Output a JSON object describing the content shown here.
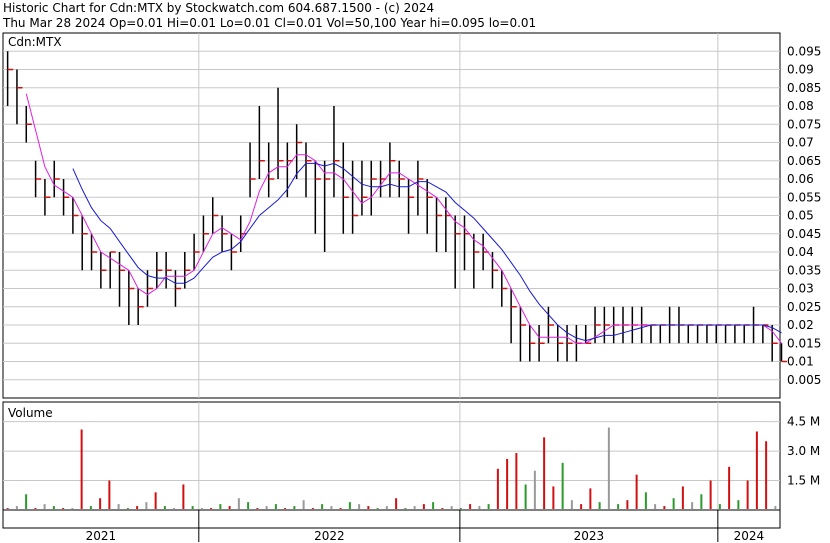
{
  "header": {
    "line1": "Historic Chart for Cdn:MTX by Stockwatch.com 604.687.1500 - (c) 2024",
    "line2": "Thu Mar 28 2024  Op=0.01  Hi=0.01  Lo=0.01  Cl=0.01  Vol=50,100  Year hi=0.095  lo=0.01"
  },
  "chart_data": [
    {
      "type": "line",
      "title": "Cdn:MTX",
      "y_ticks": [
        "0.095",
        "0.09",
        "0.085",
        "0.08",
        "0.075",
        "0.07",
        "0.065",
        "0.06",
        "0.055",
        "0.05",
        "0.045",
        "0.04",
        "0.035",
        "0.03",
        "0.025",
        "0.02",
        "0.015",
        "0.01",
        "0.005"
      ],
      "ylim": [
        0,
        0.1
      ],
      "x_labels": [
        "2021",
        "2022",
        "2023",
        "2024"
      ],
      "grid": true,
      "series": [],
      "moving_average_colors": {
        "short": "#e020e0",
        "long": "#1a1ad0"
      },
      "price": {
        "x": [
          0.0,
          0.012,
          0.024,
          0.036,
          0.048,
          0.06,
          0.072,
          0.084,
          0.096,
          0.108,
          0.12,
          0.132,
          0.144,
          0.156,
          0.168,
          0.18,
          0.192,
          0.204,
          0.216,
          0.228,
          0.24,
          0.252,
          0.264,
          0.276,
          0.288,
          0.3,
          0.312,
          0.324,
          0.336,
          0.348,
          0.36,
          0.372,
          0.384,
          0.396,
          0.408,
          0.42,
          0.432,
          0.444,
          0.456,
          0.468,
          0.48,
          0.492,
          0.504,
          0.516,
          0.528,
          0.54,
          0.552,
          0.564,
          0.576,
          0.588,
          0.6,
          0.612,
          0.624,
          0.636,
          0.648,
          0.66,
          0.672,
          0.684,
          0.696,
          0.708,
          0.72,
          0.732,
          0.744,
          0.756,
          0.768,
          0.78,
          0.792,
          0.804,
          0.816,
          0.828,
          0.84,
          0.852,
          0.864,
          0.876,
          0.888,
          0.9,
          0.912,
          0.924,
          0.936,
          0.948,
          0.96,
          0.972,
          0.984,
          0.996
        ],
        "close": [
          0.09,
          0.085,
          0.075,
          0.06,
          0.055,
          0.06,
          0.055,
          0.05,
          0.045,
          0.04,
          0.035,
          0.04,
          0.035,
          0.03,
          0.025,
          0.03,
          0.035,
          0.035,
          0.03,
          0.035,
          0.04,
          0.045,
          0.05,
          0.045,
          0.04,
          0.045,
          0.06,
          0.065,
          0.06,
          0.065,
          0.065,
          0.07,
          0.065,
          0.06,
          0.06,
          0.065,
          0.055,
          0.05,
          0.055,
          0.06,
          0.06,
          0.065,
          0.06,
          0.055,
          0.06,
          0.055,
          0.05,
          0.05,
          0.045,
          0.045,
          0.04,
          0.04,
          0.035,
          0.03,
          0.025,
          0.02,
          0.015,
          0.015,
          0.02,
          0.015,
          0.015,
          0.015,
          0.015,
          0.02,
          0.02,
          0.02,
          0.02,
          0.02,
          0.02,
          0.02,
          0.02,
          0.02,
          0.02,
          0.02,
          0.02,
          0.02,
          0.02,
          0.02,
          0.02,
          0.02,
          0.02,
          0.02,
          0.015,
          0.01
        ],
        "high": [
          0.095,
          0.09,
          0.08,
          0.065,
          0.06,
          0.065,
          0.06,
          0.055,
          0.05,
          0.045,
          0.04,
          0.04,
          0.04,
          0.035,
          0.03,
          0.035,
          0.04,
          0.04,
          0.035,
          0.04,
          0.045,
          0.05,
          0.055,
          0.05,
          0.045,
          0.05,
          0.07,
          0.08,
          0.07,
          0.085,
          0.07,
          0.075,
          0.07,
          0.065,
          0.065,
          0.08,
          0.07,
          0.065,
          0.065,
          0.065,
          0.065,
          0.07,
          0.065,
          0.06,
          0.065,
          0.06,
          0.055,
          0.055,
          0.05,
          0.05,
          0.045,
          0.045,
          0.04,
          0.035,
          0.03,
          0.025,
          0.02,
          0.02,
          0.025,
          0.02,
          0.02,
          0.02,
          0.02,
          0.025,
          0.025,
          0.025,
          0.025,
          0.025,
          0.025,
          0.02,
          0.02,
          0.025,
          0.025,
          0.02,
          0.02,
          0.02,
          0.02,
          0.02,
          0.02,
          0.02,
          0.025,
          0.02,
          0.02,
          0.015
        ],
        "low": [
          0.08,
          0.075,
          0.07,
          0.055,
          0.05,
          0.055,
          0.05,
          0.045,
          0.035,
          0.035,
          0.03,
          0.03,
          0.025,
          0.02,
          0.02,
          0.025,
          0.03,
          0.03,
          0.025,
          0.03,
          0.035,
          0.04,
          0.045,
          0.04,
          0.035,
          0.04,
          0.055,
          0.06,
          0.055,
          0.06,
          0.055,
          0.06,
          0.055,
          0.045,
          0.04,
          0.055,
          0.045,
          0.045,
          0.05,
          0.05,
          0.055,
          0.055,
          0.055,
          0.045,
          0.05,
          0.045,
          0.04,
          0.04,
          0.03,
          0.035,
          0.03,
          0.035,
          0.03,
          0.025,
          0.015,
          0.01,
          0.01,
          0.01,
          0.015,
          0.01,
          0.01,
          0.01,
          0.015,
          0.015,
          0.015,
          0.015,
          0.015,
          0.015,
          0.015,
          0.015,
          0.015,
          0.015,
          0.015,
          0.015,
          0.015,
          0.015,
          0.015,
          0.015,
          0.015,
          0.015,
          0.015,
          0.015,
          0.01,
          0.01
        ]
      }
    },
    {
      "type": "bar",
      "title": "Volume",
      "y_ticks": [
        "4.5 M",
        "3.0 M",
        "1.5 M"
      ],
      "ylim": [
        0,
        5.5
      ],
      "x_labels": [
        "2021",
        "2022",
        "2023",
        "2024"
      ],
      "bar_colors": {
        "up": "#2a9a2a",
        "down": "#d01010",
        "flat": "#999999"
      },
      "values": [
        0.1,
        0.2,
        0.8,
        0.1,
        0.3,
        0.2,
        0.1,
        0.1,
        4.1,
        0.2,
        0.6,
        1.5,
        0.3,
        0.1,
        0.2,
        0.4,
        0.9,
        0.2,
        0.1,
        1.3,
        0.2,
        0.1,
        0.1,
        0.3,
        0.2,
        0.6,
        0.4,
        0.1,
        0.2,
        0.3,
        0.1,
        0.2,
        0.5,
        0.1,
        0.3,
        0.2,
        0.1,
        0.4,
        0.3,
        0.2,
        0.1,
        0.2,
        0.6,
        0.1,
        0.2,
        0.3,
        0.4,
        0.1,
        0.2,
        0.1,
        0.3,
        0.2,
        0.3,
        2.1,
        2.6,
        2.9,
        1.3,
        2.0,
        3.7,
        1.2,
        2.4,
        0.5,
        0.3,
        1.1,
        0.4,
        4.2,
        0.3,
        0.5,
        1.8,
        0.9,
        0.3,
        0.2,
        0.6,
        1.2,
        0.4,
        0.8,
        1.5,
        0.3,
        2.2,
        0.5,
        1.5,
        4.0,
        3.5,
        0.2
      ],
      "directions": [
        "d",
        "f",
        "u",
        "d",
        "f",
        "u",
        "d",
        "f",
        "d",
        "u",
        "d",
        "d",
        "f",
        "u",
        "d",
        "f",
        "d",
        "u",
        "f",
        "d",
        "u",
        "f",
        "d",
        "u",
        "d",
        "f",
        "u",
        "d",
        "f",
        "u",
        "d",
        "u",
        "f",
        "d",
        "u",
        "f",
        "d",
        "u",
        "f",
        "d",
        "u",
        "f",
        "d",
        "u",
        "f",
        "d",
        "u",
        "d",
        "f",
        "u",
        "d",
        "f",
        "u",
        "d",
        "d",
        "d",
        "u",
        "f",
        "d",
        "d",
        "u",
        "f",
        "d",
        "d",
        "u",
        "f",
        "u",
        "d",
        "d",
        "u",
        "f",
        "d",
        "u",
        "d",
        "f",
        "u",
        "d",
        "u",
        "d",
        "u",
        "d",
        "d",
        "d",
        "f"
      ]
    }
  ]
}
